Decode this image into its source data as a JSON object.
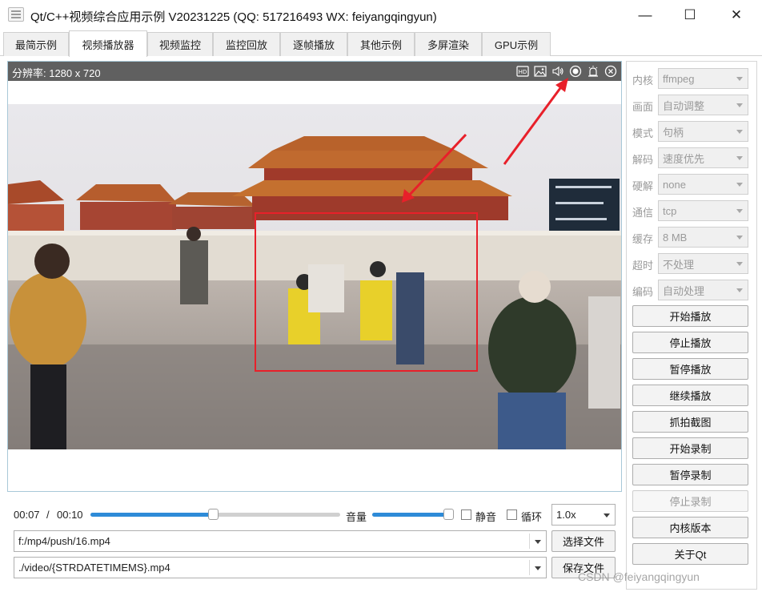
{
  "window": {
    "title": "Qt/C++视频综合应用示例 V20231225 (QQ: 517216493 WX: feiyangqingyun)",
    "minimize_glyph": "—",
    "maximize_glyph": "☐",
    "close_glyph": "✕"
  },
  "tabs": [
    {
      "label": "最简示例"
    },
    {
      "label": "视频播放器",
      "active": true
    },
    {
      "label": "视频监控"
    },
    {
      "label": "监控回放"
    },
    {
      "label": "逐帧播放"
    },
    {
      "label": "其他示例"
    },
    {
      "label": "多屏渲染"
    },
    {
      "label": "GPU示例"
    }
  ],
  "video": {
    "resolution_label": "分辨率: 1280 x 720",
    "toolbar_icons": [
      "hd-icon",
      "snapshot-icon",
      "volume-icon",
      "record-icon",
      "alarm-icon",
      "close-circle-icon"
    ]
  },
  "controls": {
    "current_time": "00:07",
    "separator": "/",
    "total_time": "00:10",
    "progress": 0.49,
    "volume_label": "音量",
    "volume": 1.0,
    "mute_label": "静音",
    "mute_checked": false,
    "loop_label": "循环",
    "loop_checked": false,
    "speed": "1.0x",
    "file_url": "f:/mp4/push/16.mp4",
    "choose_file_label": "选择文件",
    "save_path": "./video/{STRDATETIMEMS}.mp4",
    "save_file_label": "保存文件"
  },
  "side_settings": [
    {
      "label": "内核",
      "value": "ffmpeg"
    },
    {
      "label": "画面",
      "value": "自动调整"
    },
    {
      "label": "模式",
      "value": "句柄"
    },
    {
      "label": "解码",
      "value": "速度优先"
    },
    {
      "label": "硬解",
      "value": "none"
    },
    {
      "label": "通信",
      "value": "tcp"
    },
    {
      "label": "缓存",
      "value": "8 MB"
    },
    {
      "label": "超时",
      "value": "不处理"
    },
    {
      "label": "编码",
      "value": "自动处理"
    }
  ],
  "side_buttons": [
    {
      "label": "开始播放",
      "enabled": true
    },
    {
      "label": "停止播放",
      "enabled": true
    },
    {
      "label": "暂停播放",
      "enabled": true
    },
    {
      "label": "继续播放",
      "enabled": true
    },
    {
      "label": "抓拍截图",
      "enabled": true
    },
    {
      "label": "开始录制",
      "enabled": true
    },
    {
      "label": "暂停录制",
      "enabled": true
    },
    {
      "label": "停止录制",
      "enabled": false
    },
    {
      "label": "内核版本",
      "enabled": true
    },
    {
      "label": "关于Qt",
      "enabled": true
    }
  ],
  "watermark": "CSDN @feiyangqingyun",
  "colors": {
    "accent": "#2e8bd8",
    "video_toolbar": "#606060",
    "annotation_red": "#e8202a"
  }
}
